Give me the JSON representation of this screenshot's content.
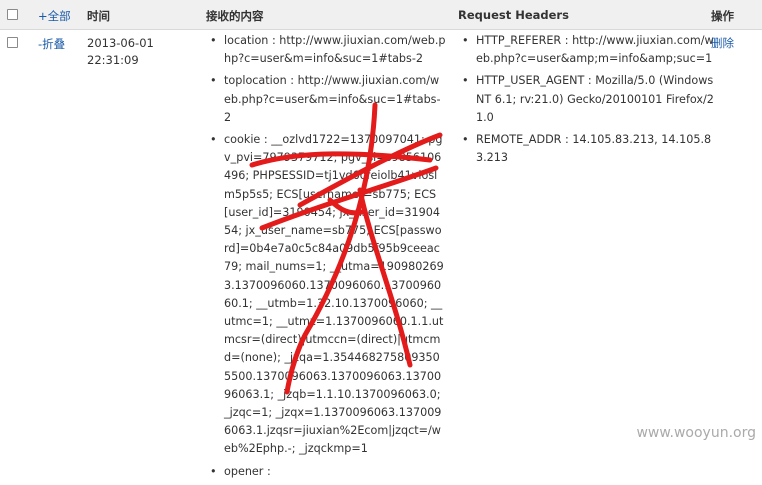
{
  "header": {
    "toggle_all": "+全部",
    "time": "时间",
    "content": "接收的内容",
    "request_headers": "Request Headers",
    "operation": "操作"
  },
  "row": {
    "fold": "-折叠",
    "date": "2013-06-01",
    "clock": "22:31:09",
    "content": [
      "location : http://www.jiuxian.com/web.php?c=user&m=info&suc=1#tabs-2",
      "toplocation : http://www.jiuxian.com/web.php?c=user&m=info&suc=1#tabs-2",
      "cookie : __ozlvd1722=1370097041; pgv_pvi=7979379712; pgv_si=s9856106496; PHPSESSID=tj1vd6ofeiolb41vloslm5p5s5; ECS[username]=sb775; ECS[user_id]=3190454; jx_user_id=3190454; jx_user_name=sb775; ECS[password]=0b4e7a0c5c84a09db5f95b9ceeac79; mail_nums=1; __utma=1909802693.1370096060.1370096060.1370096060.1; __utmb=1.32.10.1370096060; __utmc=1; __utmz=1.1370096060.1.1.utmcsr=(direct)|utmccn=(direct)|utmcmd=(none); _jzqa=1.3544682758093505500.1370096063.1370096063.1370096063.1; _jzqb=1.1.10.1370096063.0; _jzqc=1; _jzqx=1.1370096063.1370096063.1.jzqsr=jiuxian%2Ecom|jzqct=/web%2Ephp.-; _jzqckmp=1",
      "opener :"
    ],
    "headers": [
      "HTTP_REFERER : http://www.jiuxian.com/web.php?c=user&amp;m=info&amp;suc=1",
      "HTTP_USER_AGENT : Mozilla/5.0 (Windows NT 6.1; rv:21.0) Gecko/20100101 Firefox/21.0",
      "REMOTE_ADDR : 14.105.83.213, 14.105.83.213"
    ],
    "delete": "删除"
  },
  "watermark": "www.wooyun.org",
  "colors": {
    "link": "#1a5aa8",
    "header_bg": "#f0f0f0",
    "scribble": "#e31b1b"
  }
}
